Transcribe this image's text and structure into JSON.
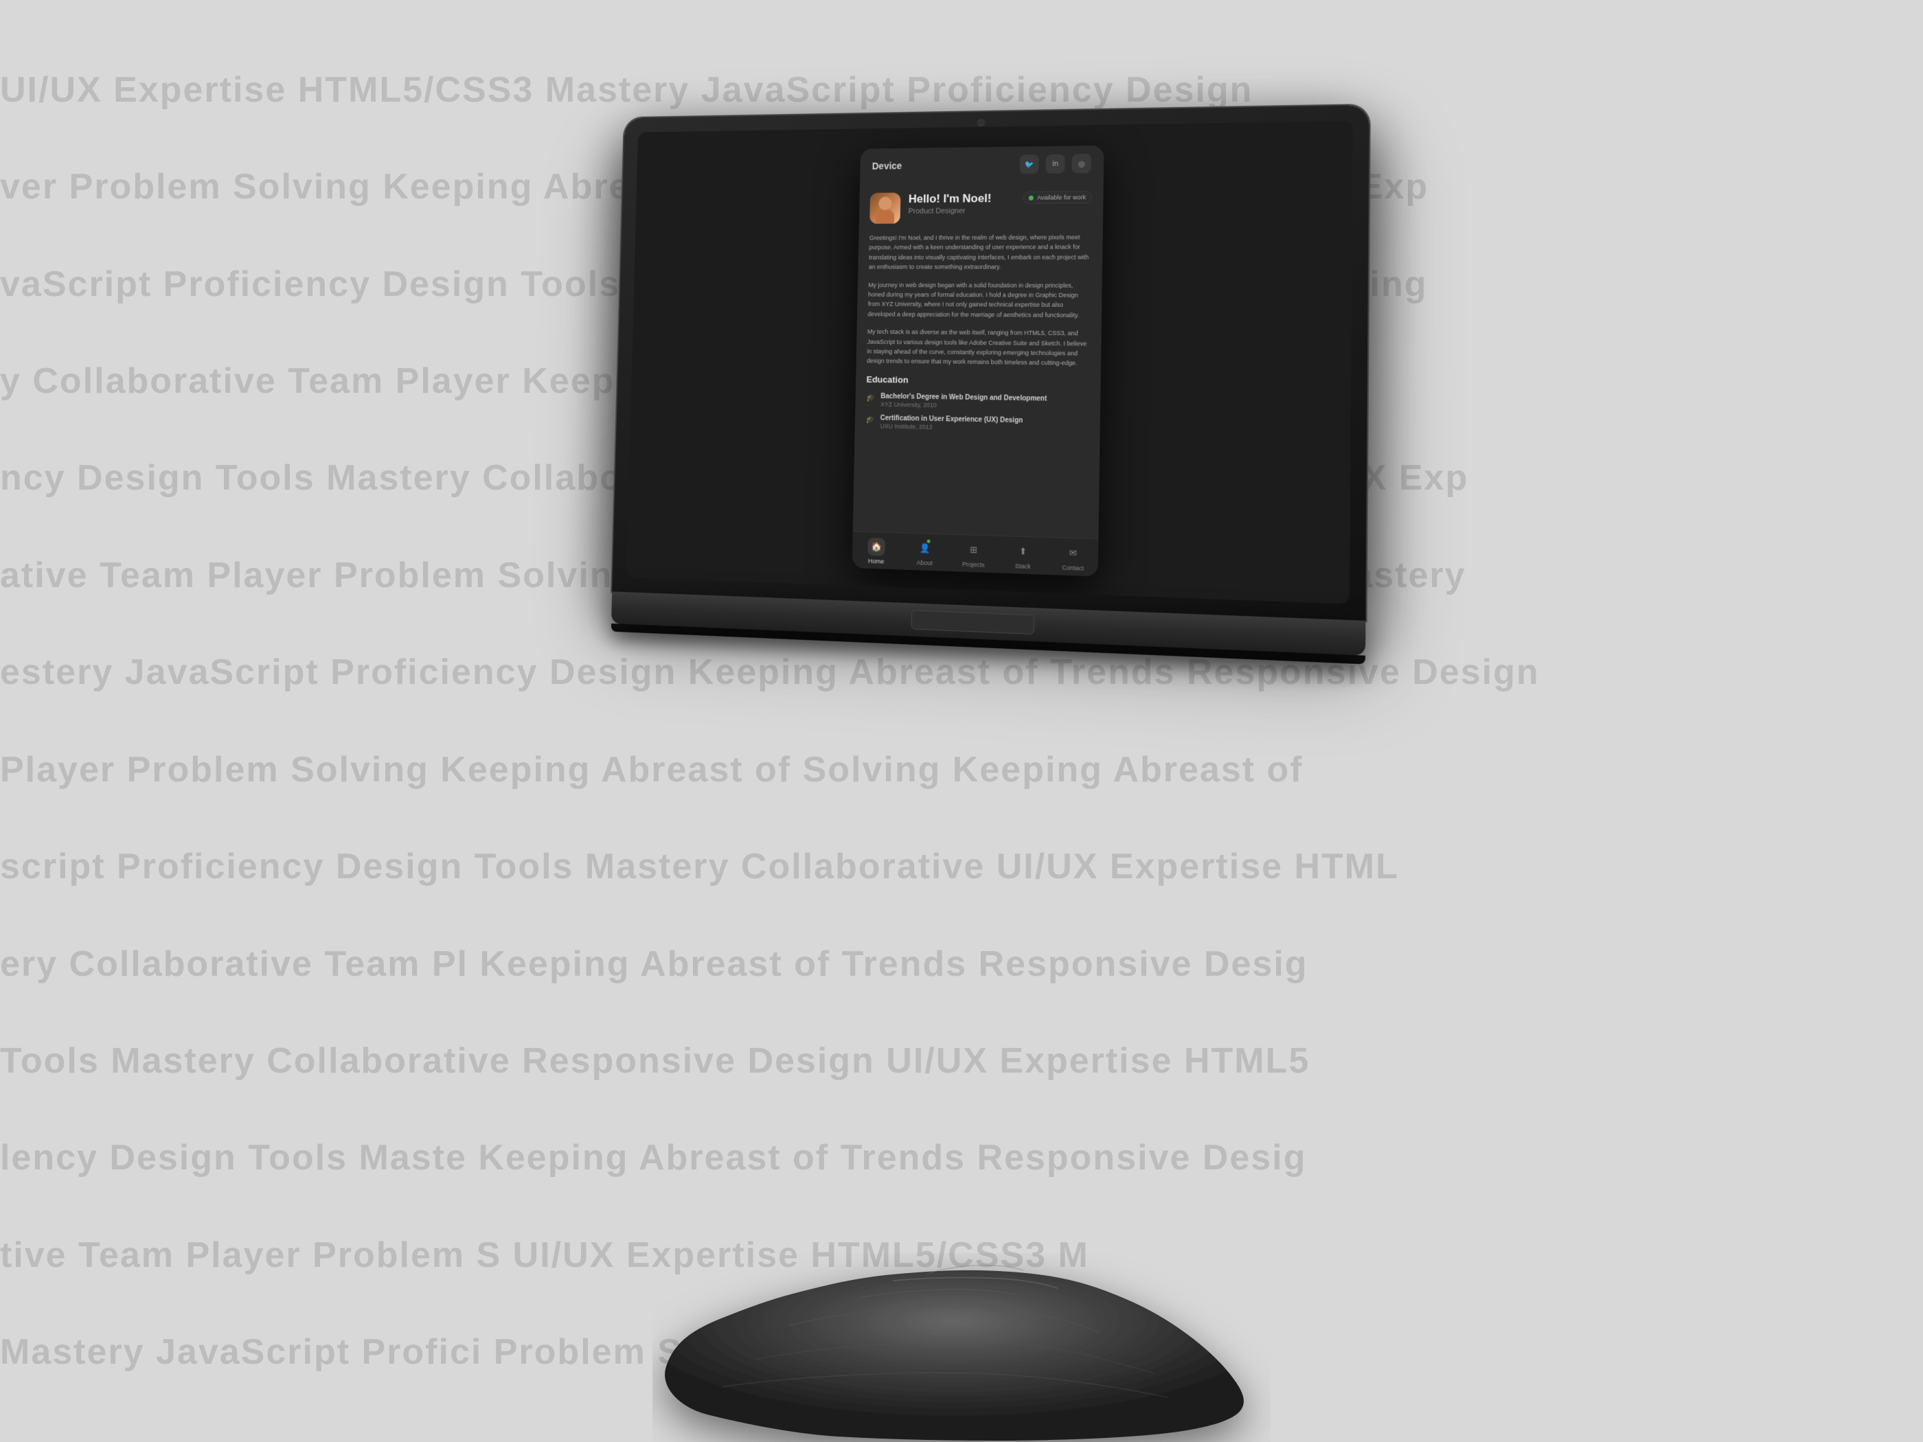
{
  "page": {
    "background_color": "#d8d8d8"
  },
  "bg_watermark": {
    "rows": [
      "UI/UX Expertise   HTML5/CSS3 Mastery   JavaScript Proficiency   Design",
      "ver   Problem Solving   Keeping Abreast of Trends   Responsive Design   UI/UX Exp",
      "vaScript Proficiency   Design Tools Mastery   Collaborative Team Player   Keeping",
      "y   Collaborative Team Player   Keeping Abreast of Trends   Responsive De",
      "ncy   Design Tools Mastery   Collaborative Team Player   Problem Solving   UI/UX Exp",
      "ative Team Player   Problem Solving   JavaScript Proficiency   Design Tools Mastery",
      "estery   JavaScript Proficiency   Design   Keeping Abreast of Trends   Responsive Design",
      "Player   Problem Solving   Keeping Abreast of   Solving   Keeping Abreast of",
      "script Proficiency   Design Tools Mastery   Collaborative   UI/UX Expertise   HTML",
      "ery   Collaborative Team Pl   Keeping Abreast of Trends   Responsive Desig",
      "Tools Mastery   Collaborative   Responsive Design   UI/UX Expertise   HTML5",
      "lency   Design Tools Maste   Keeping Abreast of Trends   Responsive Desig",
      "tive Team Player   Problem S   UI/UX Expertise   HTML5/CSS3 M",
      "Mastery   JavaScript Profici   Problem Solving   Keeping"
    ]
  },
  "laptop": {
    "title_bar": "Device"
  },
  "app": {
    "window": {
      "title": "Device",
      "available_text": "Available for work",
      "profile": {
        "name": "Hello! I'm Noel!",
        "role": "Product Designer",
        "bio_para1": "Greetings! I'm Noel, and I thrive in the realm of web design, where pixels meet purpose. Armed with a keen understanding of user experience and a knack for translating ideas into visually captivating interfaces, I embark on each project with an enthusiasm to create something extraordinary.",
        "bio_para2": "My journey in web design began with a solid foundation in design principles, honed during my years of formal education. I hold a degree in Graphic Design from XYZ University, where I not only gained technical expertise but also developed a deep appreciation for the marriage of aesthetics and functionality.",
        "bio_para3": "My tech stack is as diverse as the web itself, ranging from HTML5, CSS3, and JavaScript to various design tools like Adobe Creative Suite and Sketch. I believe in staying ahead of the curve, constantly exploring emerging technologies and design trends to ensure that my work remains both timeless and cutting-edge."
      },
      "education": {
        "section_title": "Education",
        "items": [
          {
            "degree": "Bachelor's Degree in Web Design and Development",
            "school": "XYZ University, 2010"
          },
          {
            "degree": "Certification in User Experience (UX) Design",
            "school": "UXU Institute, 2013"
          }
        ]
      },
      "nav": {
        "items": [
          {
            "label": "Home",
            "icon": "🏠",
            "active": true,
            "has_dot": false
          },
          {
            "label": "About",
            "icon": "👤",
            "active": false,
            "has_dot": true
          },
          {
            "label": "Projects",
            "icon": "⊞",
            "active": false,
            "has_dot": false
          },
          {
            "label": "Stack",
            "icon": "⬆",
            "active": false,
            "has_dot": false
          },
          {
            "label": "Contact",
            "icon": "✉",
            "active": false,
            "has_dot": false
          }
        ]
      },
      "social": {
        "twitter": "🐦",
        "linkedin": "in",
        "instagram": "◎"
      }
    }
  }
}
